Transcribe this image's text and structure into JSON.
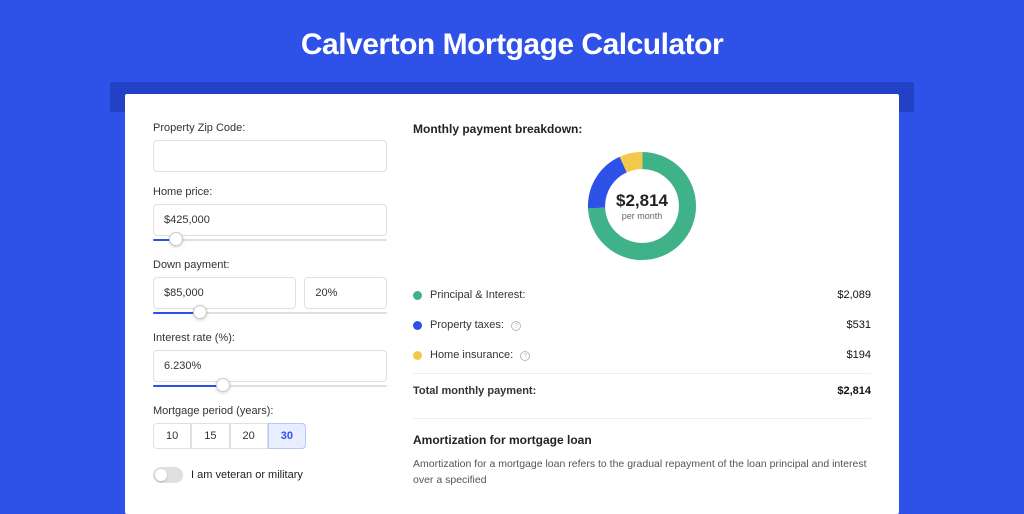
{
  "title": "Calverton Mortgage Calculator",
  "form": {
    "zip_label": "Property Zip Code:",
    "zip_value": "",
    "home_price_label": "Home price:",
    "home_price_value": "$425,000",
    "home_price_slider_pct": 10,
    "down_payment_label": "Down payment:",
    "down_payment_value": "$85,000",
    "down_payment_pct_value": "20%",
    "down_payment_slider_pct": 20,
    "interest_rate_label": "Interest rate (%):",
    "interest_rate_value": "6.230%",
    "interest_rate_slider_pct": 30,
    "period_label": "Mortgage period (years):",
    "period_options": [
      "10",
      "15",
      "20",
      "30"
    ],
    "period_selected": "30",
    "veteran_label": "I am veteran or military"
  },
  "breakdown": {
    "title": "Monthly payment breakdown:",
    "center_amount": "$2,814",
    "center_label": "per month",
    "items": [
      {
        "color": "#3fb289",
        "name": "Principal & Interest:",
        "value": "$2,089",
        "info": false
      },
      {
        "color": "#2e52e8",
        "name": "Property taxes:",
        "value": "$531",
        "info": true
      },
      {
        "color": "#f2c94c",
        "name": "Home insurance:",
        "value": "$194",
        "info": true
      }
    ],
    "total_label": "Total monthly payment:",
    "total_value": "$2,814"
  },
  "amortization": {
    "title": "Amortization for mortgage loan",
    "text": "Amortization for a mortgage loan refers to the gradual repayment of the loan principal and interest over a specified"
  },
  "chart_data": {
    "type": "pie",
    "title": "Monthly payment breakdown",
    "total": 2814,
    "unit": "USD per month",
    "series": [
      {
        "name": "Principal & Interest",
        "value": 2089,
        "color": "#3fb289"
      },
      {
        "name": "Property taxes",
        "value": 531,
        "color": "#2e52e8"
      },
      {
        "name": "Home insurance",
        "value": 194,
        "color": "#f2c94c"
      }
    ]
  }
}
